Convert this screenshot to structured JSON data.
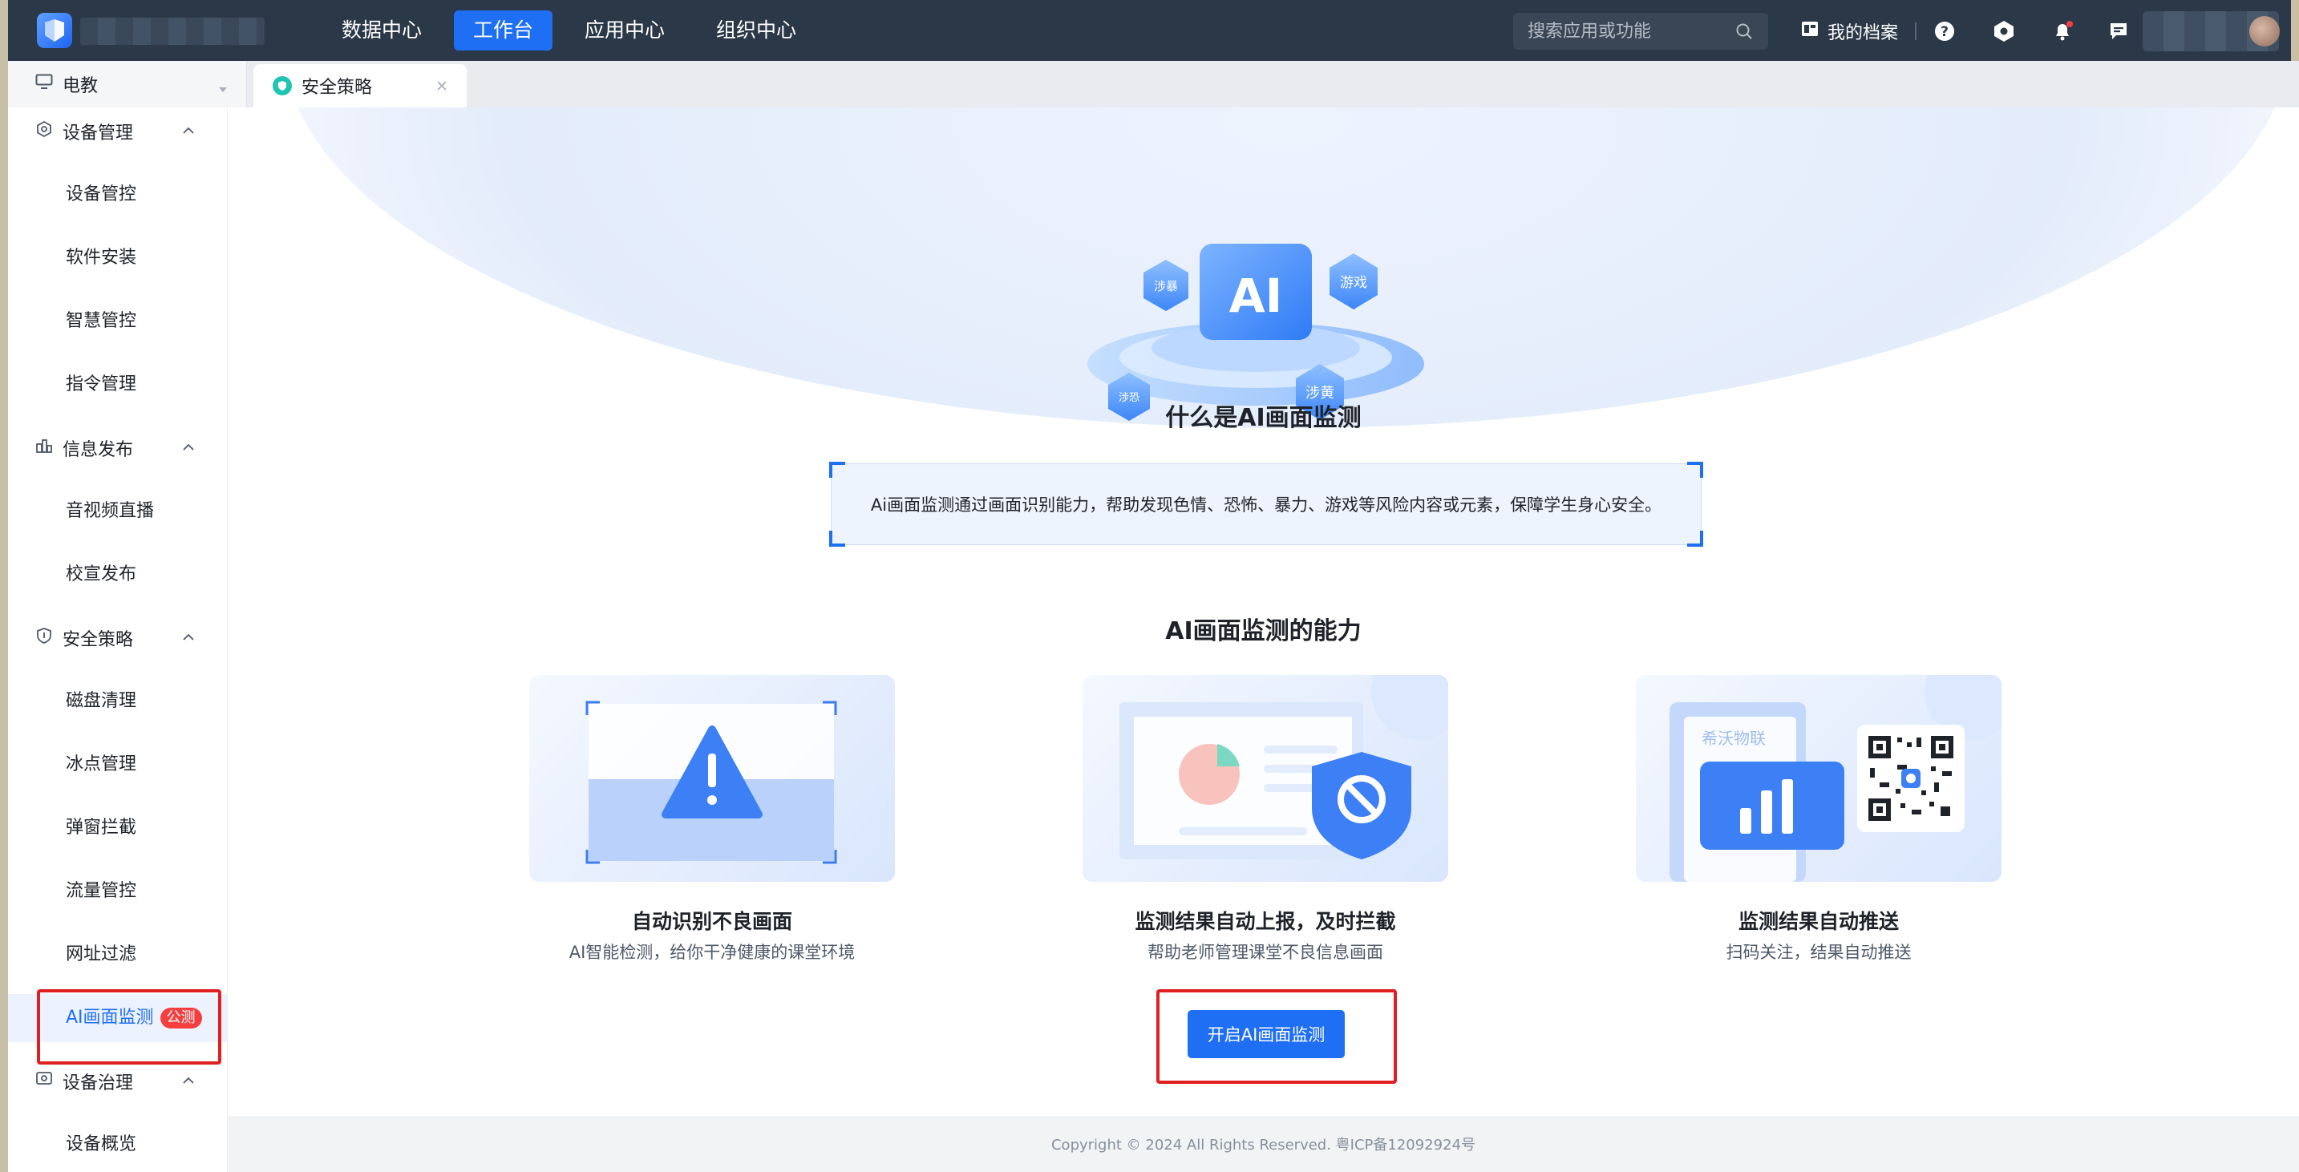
{
  "header": {
    "nav": [
      {
        "label": "数据中心",
        "active": false
      },
      {
        "label": "工作台",
        "active": true
      },
      {
        "label": "应用中心",
        "active": false
      },
      {
        "label": "组织中心",
        "active": false
      }
    ],
    "search_placeholder": "搜索应用或功能",
    "archive_label": "我的档案",
    "icons": [
      "help-icon",
      "settings-hex-icon",
      "bell-icon",
      "message-icon"
    ]
  },
  "tabs": {
    "workspace": "电教",
    "open_tab": "安全策略"
  },
  "sidebar": {
    "groups": [
      {
        "label": "设备管理",
        "icon": "device-icon",
        "items": [
          "设备管控",
          "软件安装",
          "智慧管控",
          "指令管理"
        ]
      },
      {
        "label": "信息发布",
        "icon": "publish-icon",
        "items": [
          "音视频直播",
          "校宣发布"
        ]
      },
      {
        "label": "安全策略",
        "icon": "shield-icon",
        "items": [
          "磁盘清理",
          "冰点管理",
          "弹窗拦截",
          "流量管控",
          "网址过滤",
          "AI画面监测"
        ]
      },
      {
        "label": "设备治理",
        "icon": "governance-icon",
        "items": [
          "设备概览"
        ]
      }
    ],
    "active_item": "AI画面监测",
    "beta_badge": "公测"
  },
  "main": {
    "hero_badges": {
      "center": "AI",
      "top_left": "涉暴",
      "top_right": "游戏",
      "bottom_left": "涉恐",
      "bottom_right": "涉黄"
    },
    "what_title": "什么是AI画面监测",
    "description": "Ai画面监测通过画面识别能力，帮助发现色情、恐怖、暴力、游戏等风险内容或元素，保障学生身心安全。",
    "ability_title": "AI画面监测的能力",
    "cards": [
      {
        "title": "自动识别不良画面",
        "subtitle": "AI智能检测，给你干净健康的课堂环境"
      },
      {
        "title": "监测结果自动上报，及时拦截",
        "subtitle": "帮助老师管理课堂不良信息画面"
      },
      {
        "title": "监测结果自动推送",
        "subtitle": "扫码关注，结果自动推送",
        "brand_text": "希沃物联"
      }
    ],
    "cta_label": "开启AI画面监测"
  },
  "footer": {
    "copyright": "Copyright © 2024 All Rights Reserved. 粤ICP备12092924号"
  },
  "colors": {
    "primary": "#1f6ff5",
    "topbar": "#2b3848",
    "danger": "#f53f3f"
  }
}
